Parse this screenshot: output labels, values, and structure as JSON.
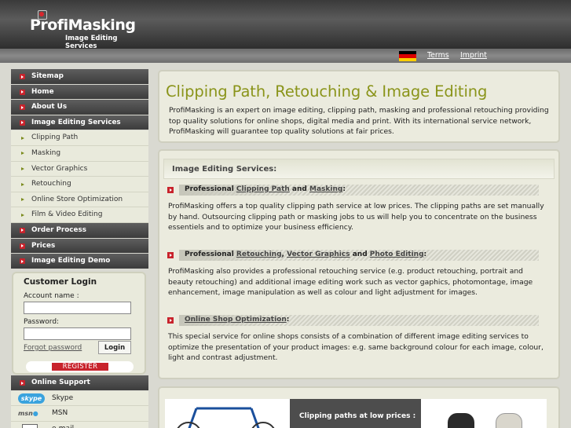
{
  "header": {
    "brand": "ProfiMasking",
    "tagline": "Image Editing Services",
    "links": {
      "terms": "Terms",
      "imprint": "Imprint"
    },
    "flag_colors": [
      "#000000",
      "#dd0000",
      "#ffce00"
    ]
  },
  "sidebar": {
    "items": [
      {
        "label": "Sitemap",
        "type": "main"
      },
      {
        "label": "Home",
        "type": "main"
      },
      {
        "label": "About Us",
        "type": "main"
      },
      {
        "label": "Image Editing Services",
        "type": "main"
      },
      {
        "label": "Clipping Path",
        "type": "sub"
      },
      {
        "label": "Masking",
        "type": "sub"
      },
      {
        "label": "Vector Graphics",
        "type": "sub"
      },
      {
        "label": "Retouching",
        "type": "sub"
      },
      {
        "label": "Online Store Optimization",
        "type": "sub"
      },
      {
        "label": "Film & Video Editing",
        "type": "sub"
      },
      {
        "label": "Order Process",
        "type": "main"
      },
      {
        "label": "Prices",
        "type": "main"
      },
      {
        "label": "Image Editing Demo",
        "type": "main"
      }
    ]
  },
  "login": {
    "title": "Customer Login",
    "account_label": "Account name :",
    "password_label": "Password:",
    "account_value": "",
    "password_value": "",
    "forgot": "Forgot password",
    "button": "Login",
    "register": "REGISTER"
  },
  "support": {
    "title": "Online Support",
    "items": [
      {
        "label": "Skype",
        "icon": "skype-icon"
      },
      {
        "label": "MSN",
        "icon": "msn-icon"
      },
      {
        "label": "e-mail",
        "icon": "mail-icon"
      }
    ]
  },
  "intro": {
    "title": "Clipping Path, Retouching & Image Editing",
    "text": "ProfiMasking is an expert on image editing, clipping path, masking and professional retouching providing top quality solutions for online shops, digital media and print. With its international service network, ProfiMasking will guarantee top quality solutions at fair prices."
  },
  "services": {
    "heading": "Image Editing Services:",
    "sections": [
      {
        "prefix": "Professional ",
        "link1": "Clipping Path",
        "mid": " and ",
        "link2": "Masking",
        "suffix": ":",
        "text": "ProfiMasking offers a top quality clipping path service at low prices. The clipping paths are set manually by hand. Outsourcing clipping path or masking jobs to us will help you to concentrate on the business essentiels and to optimize your business efficiency."
      },
      {
        "prefix": "Professional ",
        "link1": "Retouching",
        "sep": ", ",
        "link2": "Vector Graphics",
        "mid": " and ",
        "link3": "Photo Editing",
        "suffix": ":",
        "text": "ProfiMasking also provides a professional retouching service (e.g. product retouching, portrait and beauty retouching) and additional image editing work such as vector gaphics, photomontage, image enhancement, image manipulation as well as colour and light adjustment for images."
      },
      {
        "link1": "Online Shop Optimization",
        "suffix": ":",
        "text": "This special service for online shops consists of a combination of different image editing services to optimize the presentation of your product images: e.g. same background colour for each image, colour, light and contrast adjustment."
      }
    ]
  },
  "showcase": {
    "caption": "Clipping paths at low prices :"
  }
}
